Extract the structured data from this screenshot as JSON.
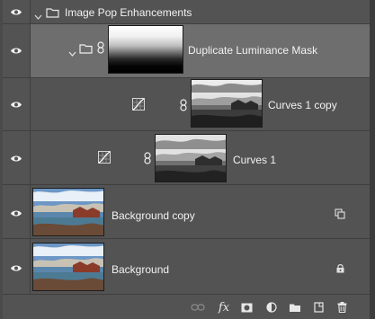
{
  "layers": {
    "group": {
      "name": "Image Pop Enhancements"
    },
    "mask": {
      "name": "Duplicate Luminance Mask"
    },
    "curves_copy": {
      "name": "Curves 1 copy"
    },
    "curves": {
      "name": "Curves 1"
    },
    "bg_copy": {
      "name": "Background copy"
    },
    "background": {
      "name": "Background"
    }
  },
  "footer": {
    "fx_label": "fx"
  },
  "colors": {
    "panel": "#535353",
    "selected_row": "#6e6e6e",
    "divider": "#3f3f3f"
  }
}
